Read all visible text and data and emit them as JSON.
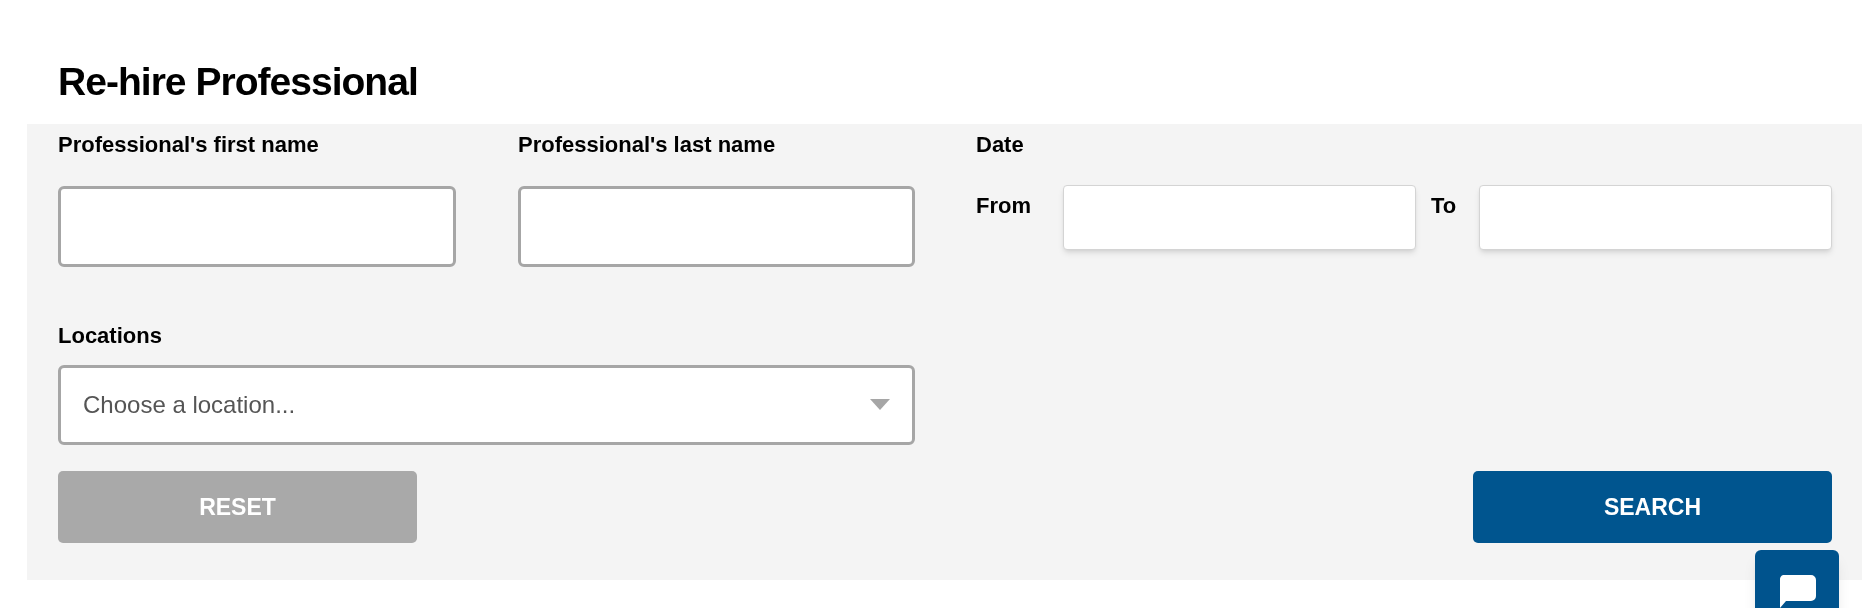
{
  "title": "Re-hire Professional",
  "first_name": {
    "label": "Professional's first name"
  },
  "last_name": {
    "label": "Professional's last name"
  },
  "date": {
    "label": "Date",
    "from_label": "From",
    "to_label": "To"
  },
  "locations": {
    "label": "Locations",
    "placeholder": "Choose a location..."
  },
  "buttons": [
    {
      "kind": "reset",
      "label": "RESET"
    },
    {
      "kind": "search",
      "label": "SEARCH"
    }
  ]
}
